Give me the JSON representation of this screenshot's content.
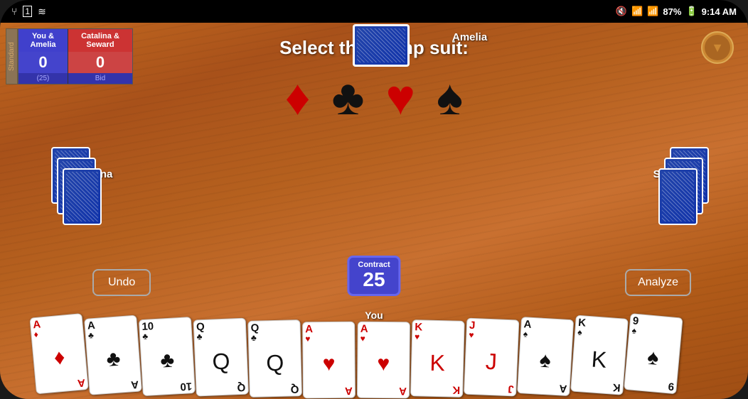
{
  "statusBar": {
    "time": "9:14 AM",
    "battery": "87%",
    "icons": [
      "usb",
      "sim",
      "wifi-off",
      "wifi",
      "signal"
    ]
  },
  "scorePanel": {
    "standardLabel": "Standard",
    "teamYou": "You &\nAmelia",
    "teamThem": "Catalina &\nSeward",
    "scoreYou": "0",
    "scoreThem": "0",
    "footerYou": "(25)",
    "footerBid": "Bid"
  },
  "game": {
    "trumpPrompt": "Select the trump suit:",
    "suits": [
      "♦",
      "♣",
      "♥",
      "♠"
    ],
    "suitNames": [
      "diamond",
      "club",
      "heart",
      "spade"
    ],
    "players": {
      "top": "Amelia",
      "left": "Catalina",
      "right": "Seward",
      "bottom": "You"
    },
    "contract": {
      "label": "Contract",
      "number": "25"
    },
    "buttons": {
      "undo": "Undo",
      "analyze": "Analyze"
    }
  },
  "hand": [
    {
      "rank": "A",
      "suit": "♦",
      "color": "red",
      "type": "pip"
    },
    {
      "rank": "A",
      "suit": "♣",
      "color": "black",
      "type": "pip"
    },
    {
      "rank": "10",
      "suit": "♣",
      "color": "black",
      "type": "pip"
    },
    {
      "rank": "Q",
      "suit": "♣",
      "color": "black",
      "type": "face",
      "face": "Q"
    },
    {
      "rank": "Q",
      "suit": "♣",
      "color": "black",
      "type": "face",
      "face": "Q"
    },
    {
      "rank": "A",
      "suit": "♥",
      "color": "red",
      "type": "pip"
    },
    {
      "rank": "A",
      "suit": "♥",
      "color": "red",
      "type": "pip"
    },
    {
      "rank": "K",
      "suit": "♥",
      "color": "red",
      "type": "face",
      "face": "K"
    },
    {
      "rank": "J",
      "suit": "♥",
      "color": "red",
      "type": "face",
      "face": "J"
    },
    {
      "rank": "A",
      "suit": "♠",
      "color": "black",
      "type": "pip"
    },
    {
      "rank": "K",
      "suit": "♠",
      "color": "black",
      "type": "face",
      "face": "K"
    },
    {
      "rank": "9",
      "suit": "♠",
      "color": "black",
      "type": "pip"
    }
  ]
}
